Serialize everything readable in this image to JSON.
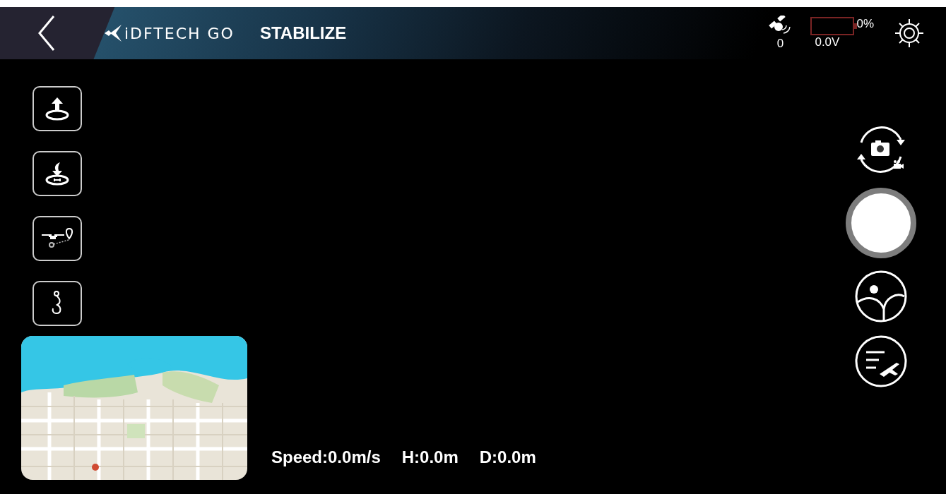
{
  "header": {
    "brand": "iDFTECH GO",
    "mode": "STABILIZE",
    "satellites": "0",
    "battery": {
      "level": 0,
      "percent": "0%",
      "voltage": "0.0V"
    }
  },
  "left_tools": [
    {
      "kind": "takeoff"
    },
    {
      "kind": "land"
    },
    {
      "kind": "waypoint"
    },
    {
      "kind": "hook"
    }
  ],
  "map": {
    "kind": "picture"
  },
  "telemetry": [
    "Speed:0.0m/s",
    "H:0.0m",
    "D:0.0m"
  ],
  "right_tools": [
    {
      "kind": "switch"
    },
    {
      "kind": "shutter"
    },
    {
      "kind": "gallery"
    },
    {
      "kind": "log"
    }
  ]
}
